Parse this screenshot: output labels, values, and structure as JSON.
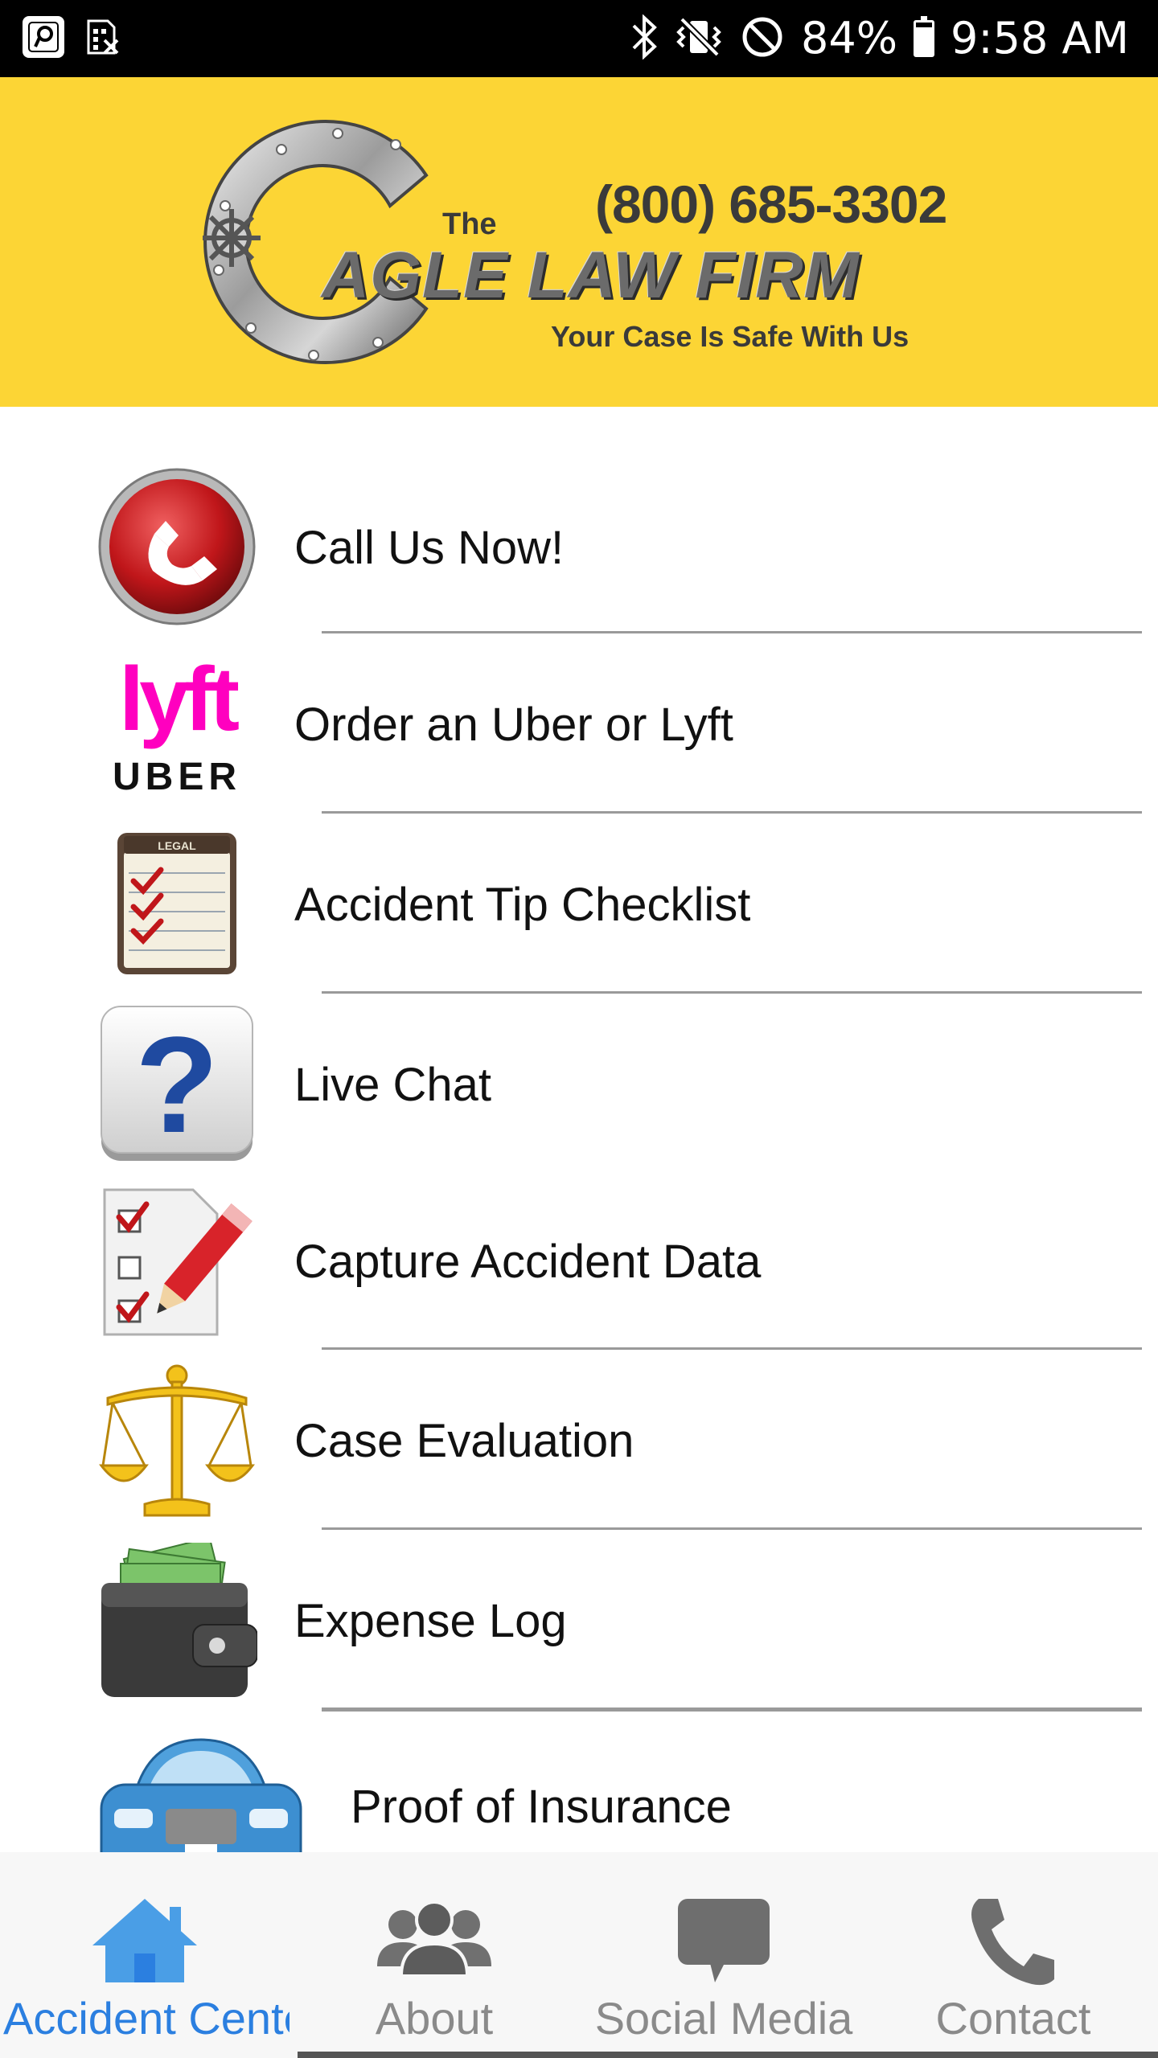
{
  "status_bar": {
    "battery": "84%",
    "battery_level": 0.84,
    "time": "9:58 AM",
    "icons": [
      "app-p-icon",
      "sim-icon",
      "bluetooth-icon",
      "vibrate-icon",
      "do-not-disturb-icon",
      "battery-icon"
    ]
  },
  "header": {
    "logo_the": "The",
    "logo_phone": "(800) 685-3302",
    "logo_name": "AGLE LAW FIRM",
    "logo_tagline": "Your Case Is Safe With Us",
    "background": "#fcd535"
  },
  "menu": {
    "items": [
      {
        "label": "Call Us Now!",
        "icon": "phone-icon"
      },
      {
        "label": "Order an Uber or Lyft",
        "icon": "lyft-uber-icon",
        "icon_text_top": "lyft",
        "icon_text_bottom": "UBER"
      },
      {
        "label": "Accident Tip Checklist",
        "icon": "legal-checklist-icon",
        "icon_text": "LEGAL"
      },
      {
        "label": "Live Chat",
        "icon": "question-icon",
        "icon_text": "?"
      },
      {
        "label": "Capture Accident Data",
        "icon": "checklist-pencil-icon"
      },
      {
        "label": "Case Evaluation",
        "icon": "scales-icon"
      },
      {
        "label": "Expense Log",
        "icon": "wallet-icon"
      },
      {
        "label": "Proof of Insurance",
        "icon": "car-icon"
      }
    ]
  },
  "tab_bar": {
    "tabs": [
      {
        "label": "Accident Center",
        "icon": "home-icon",
        "active": true
      },
      {
        "label": "About",
        "icon": "people-icon",
        "active": false
      },
      {
        "label": "Social Media",
        "icon": "chat-bubble-icon",
        "active": false
      },
      {
        "label": "Contact",
        "icon": "phone-handset-icon",
        "active": false
      }
    ],
    "active_color": "#2b7fe0",
    "inactive_color": "#8a8a8a"
  }
}
